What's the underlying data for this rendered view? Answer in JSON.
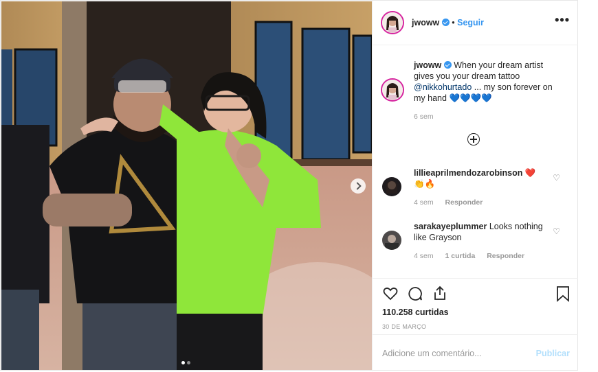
{
  "post": {
    "username": "jwoww",
    "follow_label": "Seguir",
    "more_label": "•••",
    "caption": {
      "username": "jwoww",
      "text_before": "When your dream artist gives you your dream tattoo",
      "mention": "@nikkohurtado",
      "text_after": "... my son forever on my hand",
      "emoji": "💙💙💙💙",
      "time": "6 sem"
    },
    "comments": [
      {
        "username": "lillieaprilmendozarobinson",
        "text": "❤️",
        "text2": "👏🔥",
        "time": "4 sem",
        "reply_label": "Responder"
      },
      {
        "username": "sarakayeplummer",
        "text": "Looks nothing like Grayson",
        "time": "4 sem",
        "likes": "1 curtida",
        "reply_label": "Responder"
      }
    ],
    "likes_count": "110.258 curtidas",
    "date": "30 DE MARÇO",
    "comment_placeholder": "Adicione um comentário...",
    "publish_label": "Publicar",
    "colors": {
      "accent": "#3897f0",
      "publish_disabled": "#b2dffc",
      "shirt_green": "#8fe63a"
    }
  }
}
